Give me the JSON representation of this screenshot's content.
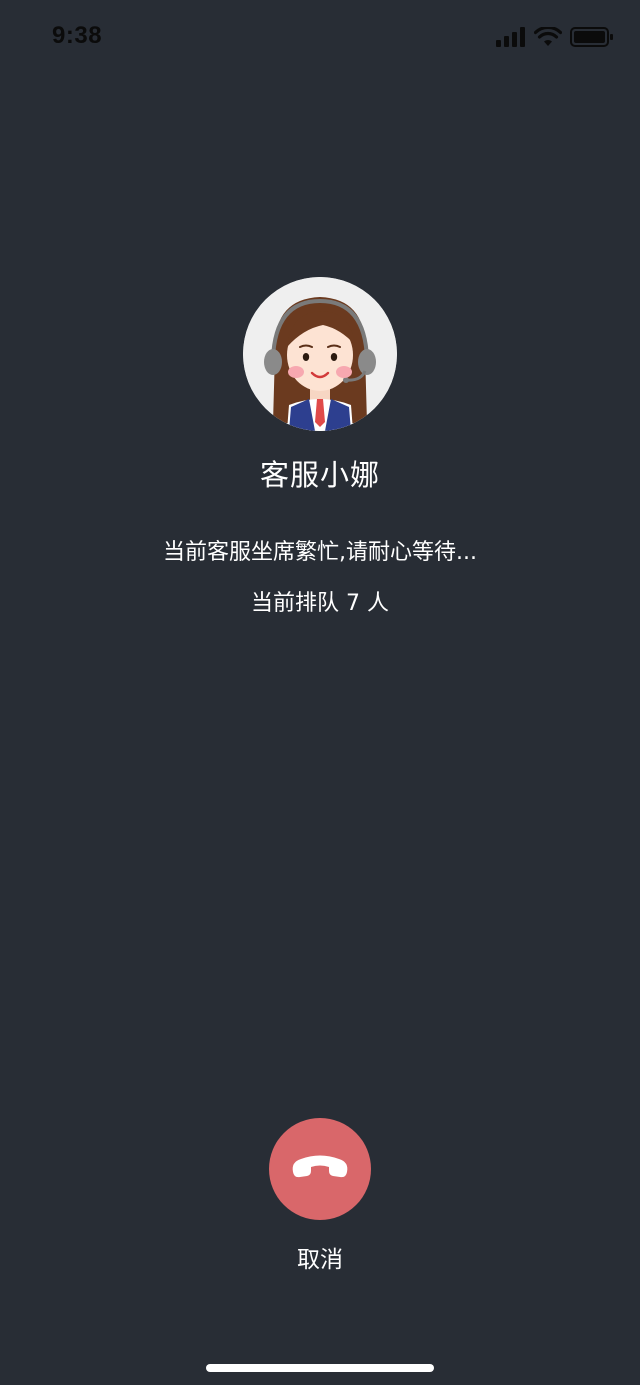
{
  "status_bar": {
    "time": "9:38",
    "icons": [
      "signal-icon",
      "wifi-icon",
      "battery-icon"
    ]
  },
  "call": {
    "agent_name": "客服小娜",
    "busy_message": "当前客服坐席繁忙,请耐心等待...",
    "queue_message": "当前排队 7 人",
    "cancel_label": "取消"
  },
  "colors": {
    "background": "#282d35",
    "hangup_button": "#d9676a",
    "text": "#ffffff"
  }
}
